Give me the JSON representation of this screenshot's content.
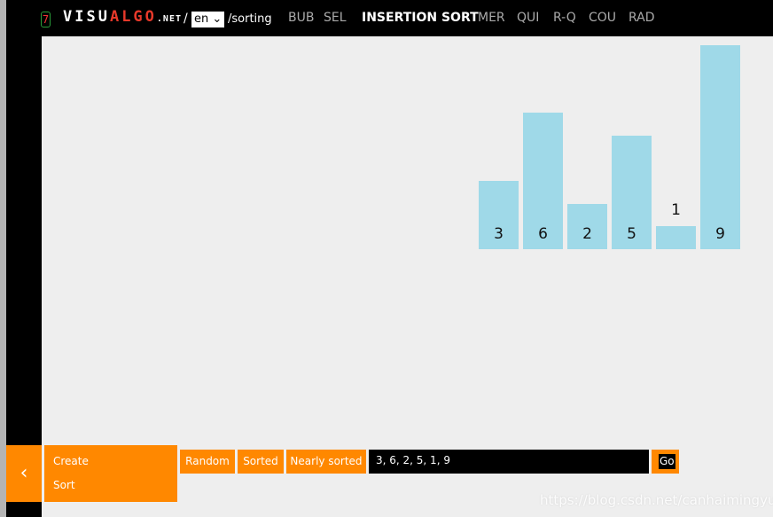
{
  "header": {
    "logo_digit": "7",
    "logo_visu": "VISU",
    "logo_algo": "ALGO",
    "logo_net": ".NET",
    "separator": "/",
    "language": "en",
    "path": "/sorting",
    "nav": [
      {
        "label": "BUB",
        "active": false
      },
      {
        "label": "SEL",
        "active": false
      },
      {
        "label": "INSERTION SORT",
        "active": true
      },
      {
        "label": "MER",
        "active": false
      },
      {
        "label": "QUI",
        "active": false
      },
      {
        "label": "R-Q",
        "active": false
      },
      {
        "label": "COU",
        "active": false
      },
      {
        "label": "RAD",
        "active": false
      }
    ]
  },
  "array": {
    "values": [
      3,
      6,
      2,
      5,
      1,
      9
    ],
    "bar_color": "#9fd9e8"
  },
  "controls": {
    "collapse_icon": "chevron-left-icon",
    "menu": [
      "Create",
      "Sort"
    ],
    "buttons": [
      "Random",
      "Sorted",
      "Nearly sorted"
    ],
    "input_value": "3, 6, 2, 5, 1, 9",
    "go_label": "Go",
    "accent": "#ff8800"
  },
  "watermark": "https://blog.csdn.net/canhaimingyue"
}
